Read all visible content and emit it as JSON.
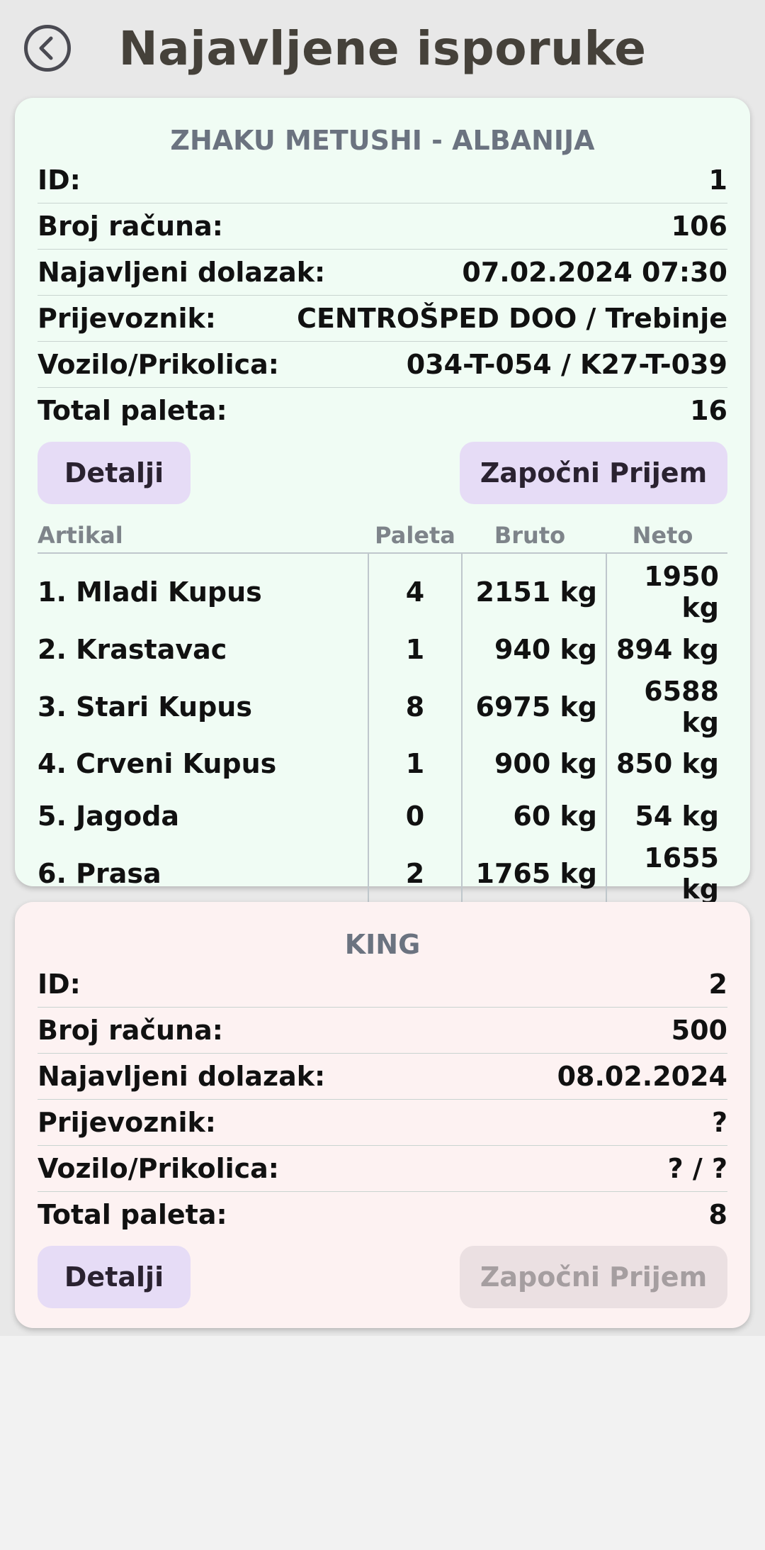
{
  "header": {
    "title": "Najavljene isporuke",
    "back_icon": "chevron-left-circle"
  },
  "labels": {
    "id": "ID:",
    "invoice": "Broj računa:",
    "arrival": "Najavljeni dolazak:",
    "carrier": "Prijevoznik:",
    "vehicle": "Vozilo/Prikolica:",
    "pallets": "Total paleta:",
    "details_button": "Detalji",
    "start_button": "Započni Prijem"
  },
  "shipments": [
    {
      "supplier": "ZHAKU METUSHI - ALBANIJA",
      "id": "1",
      "invoice": "106",
      "arrival": "07.02.2024 07:30",
      "carrier": "CENTROŠPED DOO / Trebinje",
      "vehicle": "034-T-054 / K27-T-039",
      "pallets": "16",
      "start_enabled": true,
      "background": "#f0fcf4",
      "items_header": {
        "article": "Artikal",
        "pallets": "Paleta",
        "gross": "Bruto",
        "net": "Neto"
      },
      "items": [
        {
          "name": "1. Mladi Kupus",
          "pallets": "4",
          "gross": "2151 kg",
          "net": "1950 kg"
        },
        {
          "name": "2. Krastavac",
          "pallets": "1",
          "gross": "940 kg",
          "net": "894 kg"
        },
        {
          "name": "3. Stari Kupus",
          "pallets": "8",
          "gross": "6975 kg",
          "net": "6588 kg"
        },
        {
          "name": "4. Crveni Kupus",
          "pallets": "1",
          "gross": "900 kg",
          "net": "850 kg"
        },
        {
          "name": "5. Jagoda",
          "pallets": "0",
          "gross": "60 kg",
          "net": "54 kg"
        },
        {
          "name": "6. Prasa",
          "pallets": "2",
          "gross": "1765 kg",
          "net": "1655 kg"
        }
      ]
    },
    {
      "supplier": "KING",
      "id": "2",
      "invoice": "500",
      "arrival": "08.02.2024",
      "carrier": "?",
      "vehicle": "? / ?",
      "pallets": "8",
      "start_enabled": false,
      "background": "#fdf2f2"
    }
  ]
}
